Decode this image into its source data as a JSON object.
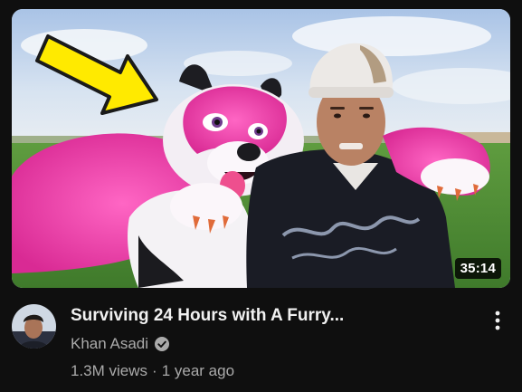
{
  "video": {
    "title": "Surviving 24 Hours with A Furry...",
    "duration": "35:14",
    "channel_name": "Khan Asadi",
    "views": "1.3M views",
    "separator": "·",
    "age": "1 year ago",
    "verified": true
  },
  "icons": {
    "verified": "verified-check-icon",
    "more": "more-vert-icon",
    "arrow": "yellow-arrow"
  },
  "colors": {
    "background": "#0f0f0f",
    "title": "#f1f1f1",
    "secondary_text": "#aaaaaa",
    "arrow": "#ffea00",
    "fur_pink": "#ee3fa8"
  }
}
